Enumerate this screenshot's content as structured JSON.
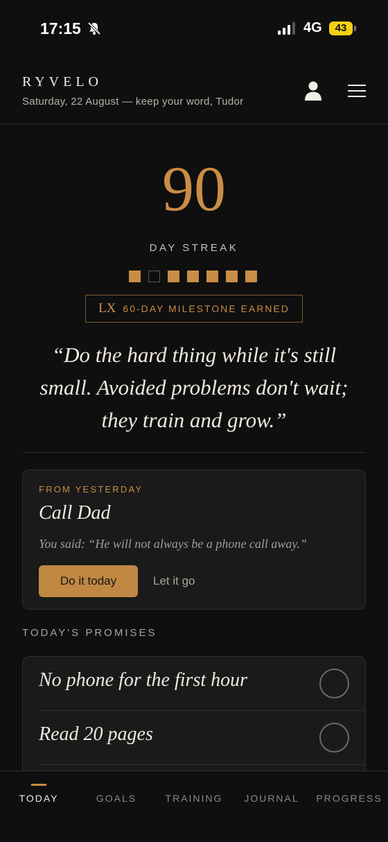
{
  "status_bar": {
    "time": "17:15",
    "network": "4G",
    "battery": "43"
  },
  "header": {
    "brand": "RYVELO",
    "subtitle": "Saturday, 22 August — keep your word, Tudor"
  },
  "streak": {
    "days": "90",
    "label": "DAY STREAK",
    "week": [
      true,
      false,
      true,
      true,
      true,
      true,
      true
    ],
    "milestone_roman": "LX",
    "milestone_text": "60-DAY MILESTONE EARNED"
  },
  "quote": "“Do the hard thing while it's still small. Avoided problems don't wait; they train and grow.”",
  "yesterday": {
    "eyebrow": "FROM YESTERDAY",
    "title": "Call Dad",
    "note": "You said: “He will not always be a phone call away.”",
    "primary_action": "Do it today",
    "secondary_action": "Let it go"
  },
  "promises": {
    "title": "TODAY'S PROMISES",
    "items": [
      {
        "text": "No phone for the first hour",
        "done": false
      },
      {
        "text": "Read 20 pages",
        "done": false
      }
    ]
  },
  "nav": {
    "active": "TODAY",
    "items": [
      "TODAY",
      "GOALS",
      "TRAINING",
      "JOURNAL",
      "PROGRESS"
    ]
  },
  "colors": {
    "accent": "#c98d45",
    "background": "#0f0f0f",
    "card": "#1a1a1a",
    "battery": "#f4d012"
  }
}
